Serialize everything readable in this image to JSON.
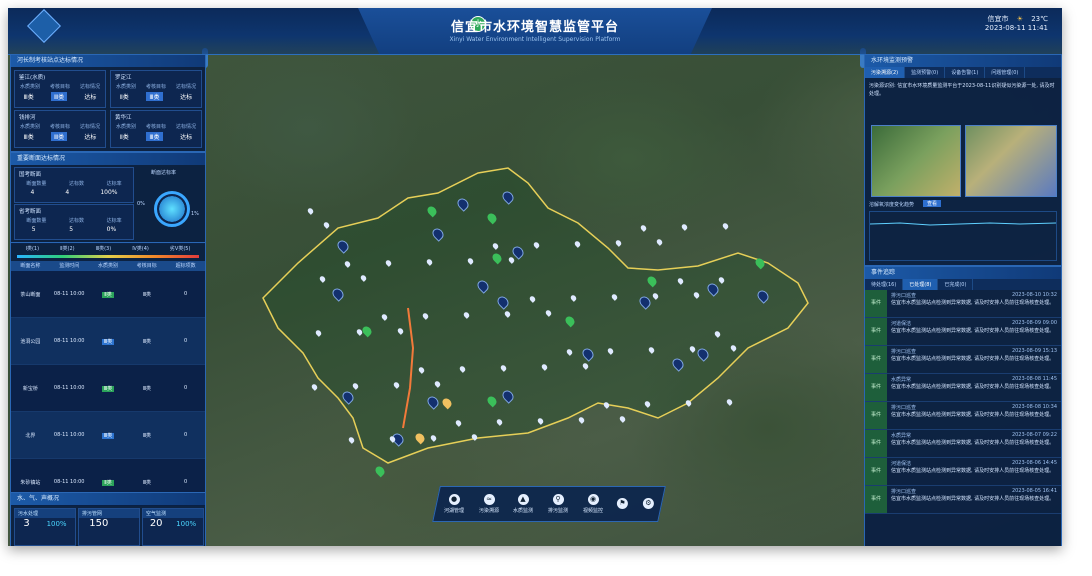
{
  "header": {
    "title": "信宜市水环境智慧监管平台",
    "subtitle": "Xinyi Water Environment Intelligent Supervision Platform",
    "logo_text": "水",
    "user_city": "信宜市",
    "weather": "☀",
    "temperature": "23℃",
    "datetime": "2023-08-11 11:41"
  },
  "left_top": {
    "title": "河长制考核站点达标情况",
    "cards": [
      {
        "name": "鉴江(水质)",
        "labels": [
          "水质类别",
          "考核目标",
          "达标情况"
        ],
        "values": [
          "Ⅲ类",
          "Ⅲ类",
          "达标"
        ]
      },
      {
        "name": "罗定江",
        "labels": [
          "水质类别",
          "考核目标",
          "达标情况"
        ],
        "values": [
          "Ⅱ类",
          "Ⅲ类",
          "达标"
        ]
      },
      {
        "name": "钱排河",
        "labels": [
          "水质类别",
          "考核目标",
          "达标情况"
        ],
        "values": [
          "Ⅲ类",
          "Ⅲ类",
          "达标"
        ]
      },
      {
        "name": "黄华江",
        "labels": [
          "水质类别",
          "考核目标",
          "达标情况"
        ],
        "values": [
          "Ⅱ类",
          "Ⅲ类",
          "达标"
        ]
      }
    ]
  },
  "left_mid": {
    "title": "重要断面达标情况",
    "sub1": "国考断面",
    "sub1_labels": [
      "断面数量",
      "达标数",
      "达标率"
    ],
    "sub1_values": [
      "4",
      "4",
      "100%"
    ],
    "sub2": "省考断面",
    "sub2_labels": [
      "断面数量",
      "达标数",
      "达标率"
    ],
    "sub2_values": [
      "5",
      "5",
      "0%"
    ],
    "gauge_label": "断面达标率",
    "gauge_value": "0%",
    "gauge_right": "1%"
  },
  "left_table": {
    "legend": [
      "Ⅰ类(1)",
      "Ⅱ类(2)",
      "Ⅲ类(3)",
      "Ⅳ类(4)",
      "劣Ⅴ类(5)"
    ],
    "headers": [
      "断面名称",
      "监测时间",
      "水质类别",
      "考核目标",
      "超标项数"
    ],
    "rows": [
      {
        "name": "茶山断面",
        "time": "08-11 10:00",
        "cls": "Ⅱ类",
        "target": "Ⅲ类",
        "over": "0"
      },
      {
        "name": "池洞公园",
        "time": "08-11 10:00",
        "cls": "Ⅲ类",
        "target": "Ⅲ类",
        "over": "0"
      },
      {
        "name": "新宝桥",
        "time": "08-11 10:00",
        "cls": "Ⅲ类",
        "target": "Ⅲ类",
        "over": "0"
      },
      {
        "name": "北界",
        "time": "08-11 10:00",
        "cls": "Ⅲ类",
        "target": "Ⅲ类",
        "over": "0"
      },
      {
        "name": "朱砂镇站",
        "time": "08-11 10:00",
        "cls": "Ⅱ类",
        "target": "Ⅲ类",
        "over": "0"
      }
    ]
  },
  "left_bottom": {
    "title": "水、气、声概况",
    "boxes": [
      {
        "h": "污水处理",
        "a": "3",
        "b": "100%"
      },
      {
        "h": "排污管网",
        "a": "150",
        "b": ""
      },
      {
        "h": "空气监测",
        "a": "20",
        "b": "100%"
      }
    ]
  },
  "right_top": {
    "title": "水环境监测预警",
    "tabs": [
      "污染溯源(2)",
      "监测预警(0)",
      "设备告警(1)",
      "问题管理(0)"
    ],
    "text": "污染源识别: 信宜市水环境质量监测平台于2023-08-11识别疑似污染源一处, 请及时处理。",
    "chart_label": "溶解氧浓度变化趋势",
    "chart_btn": "查看"
  },
  "right_bottom": {
    "title": "事件追踪",
    "tabs": [
      "待处理(16)",
      "已处理(8)",
      "已完成(0)"
    ],
    "events": [
      {
        "title": "排污口巡查",
        "time": "2023-08-10 10:32",
        "desc": "信宜市水质监测站点检测到异常数据, 请及时安排人员前往现场核查处理。"
      },
      {
        "title": "河道保洁",
        "time": "2023-08-09 09:00",
        "desc": "信宜市水质监测站点检测到异常数据, 请及时安排人员前往现场核查处理。"
      },
      {
        "title": "排污口巡查",
        "time": "2023-08-09 15:13",
        "desc": "信宜市水质监测站点检测到异常数据, 请及时安排人员前往现场核查处理。"
      },
      {
        "title": "水质异常",
        "time": "2023-08-08 11:45",
        "desc": "信宜市水质监测站点检测到异常数据, 请及时安排人员前往现场核查处理。"
      },
      {
        "title": "排污口巡查",
        "time": "2023-08-08 10:34",
        "desc": "信宜市水质监测站点检测到异常数据, 请及时安排人员前往现场核查处理。"
      },
      {
        "title": "水质异常",
        "time": "2023-08-07 09:22",
        "desc": "信宜市水质监测站点检测到异常数据, 请及时安排人员前往现场核查处理。"
      },
      {
        "title": "河道保洁",
        "time": "2023-08-06 14:45",
        "desc": "信宜市水质监测站点检测到异常数据, 请及时安排人员前往现场核查处理。"
      },
      {
        "title": "排污口巡查",
        "time": "2023-08-05 16:41",
        "desc": "信宜市水质监测站点检测到异常数据, 请及时安排人员前往现场核查处理。"
      }
    ],
    "event_icon": "事件"
  },
  "toolbar": {
    "items": [
      {
        "label": "河湖管理",
        "icon": "●"
      },
      {
        "label": "污染溯源",
        "icon": "≈"
      },
      {
        "label": "水质监测",
        "icon": "▲"
      },
      {
        "label": "排污监测",
        "icon": "⚲"
      },
      {
        "label": "视频监控",
        "icon": "◉"
      },
      {
        "label": "",
        "icon": "⚑"
      },
      {
        "label": "",
        "icon": "⚙"
      }
    ]
  }
}
